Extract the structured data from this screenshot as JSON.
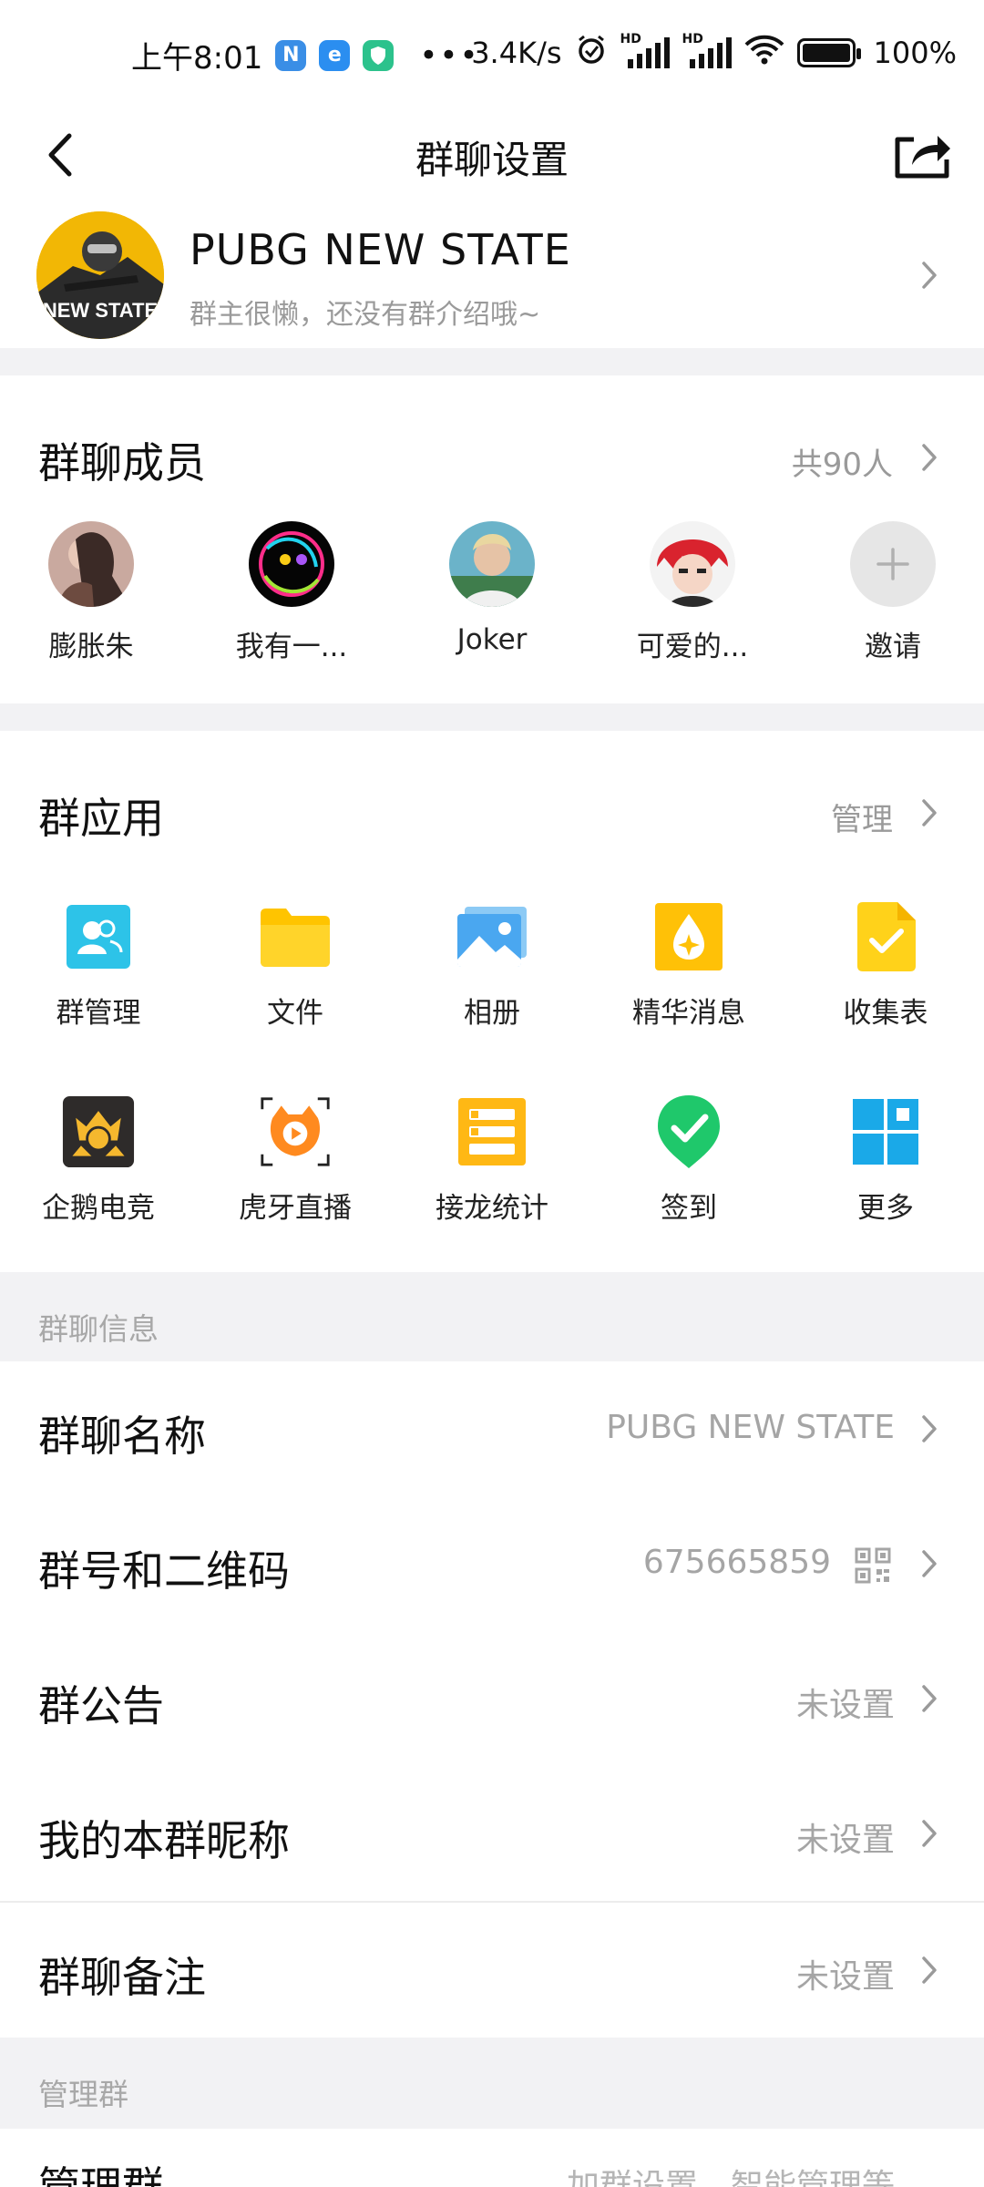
{
  "status_bar": {
    "time": "上午8:01",
    "net_speed": "3.4K/s",
    "battery": "100%",
    "hd1": "HD",
    "hd2": "HD"
  },
  "header": {
    "title": "群聊设置"
  },
  "group": {
    "name": "PUBG  NEW STATE",
    "description": "群主很懒，还没有群介绍哦~",
    "avatar_text": "NEW STATE"
  },
  "members": {
    "title": "群聊成员",
    "count": "共90人",
    "list": [
      {
        "name": "膨胀朱"
      },
      {
        "name": "我有一..."
      },
      {
        "name": "Joker"
      },
      {
        "name": "可爱的..."
      }
    ],
    "invite_label": "邀请"
  },
  "apps": {
    "title": "群应用",
    "manage": "管理",
    "items": [
      {
        "label": "群管理",
        "icon": "group-manage-icon"
      },
      {
        "label": "文件",
        "icon": "folder-icon"
      },
      {
        "label": "相册",
        "icon": "photo-album-icon"
      },
      {
        "label": "精华消息",
        "icon": "essence-message-icon"
      },
      {
        "label": "收集表",
        "icon": "collection-form-icon"
      },
      {
        "label": "企鹅电竞",
        "icon": "penguin-esports-icon"
      },
      {
        "label": "虎牙直播",
        "icon": "huya-live-icon"
      },
      {
        "label": "接龙统计",
        "icon": "relay-stats-icon"
      },
      {
        "label": "签到",
        "icon": "check-in-icon"
      },
      {
        "label": "更多",
        "icon": "more-apps-icon"
      }
    ]
  },
  "info_section": {
    "title": "群聊信息",
    "rows": [
      {
        "label": "群聊名称",
        "value": "PUBG  NEW STATE"
      },
      {
        "label": "群号和二维码",
        "value": "675665859"
      },
      {
        "label": "群公告",
        "value": "未设置"
      },
      {
        "label": "我的本群昵称",
        "value": "未设置"
      },
      {
        "label": "群聊备注",
        "value": "未设置"
      }
    ]
  },
  "manage_section": {
    "title": "管理群",
    "partial_row_label": "管理群",
    "partial_row_value": "加群设置、智能管理等"
  },
  "colors": {
    "accent_blue": "#1ea0f0",
    "gray_text": "#a5a5a5",
    "section_bg": "#f2f2f4"
  }
}
